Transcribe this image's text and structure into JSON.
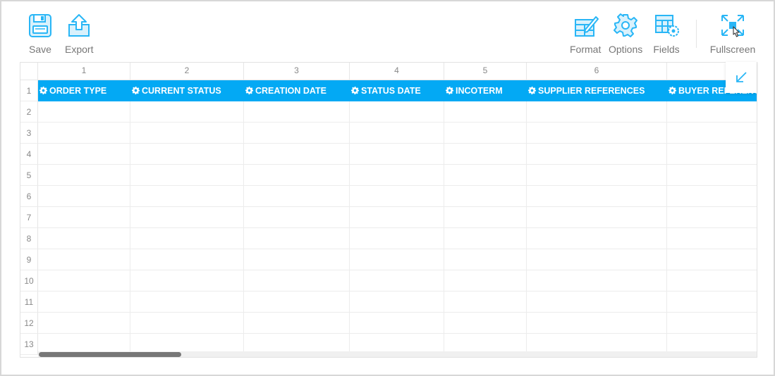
{
  "toolbar": {
    "left": [
      {
        "label": "Save",
        "icon": "save-icon"
      },
      {
        "label": "Export",
        "icon": "export-icon"
      }
    ],
    "right": [
      {
        "label": "Format",
        "icon": "format-icon"
      },
      {
        "label": "Options",
        "icon": "options-icon"
      },
      {
        "label": "Fields",
        "icon": "fields-icon"
      },
      {
        "label": "Fullscreen",
        "icon": "fullscreen-icon"
      }
    ]
  },
  "grid": {
    "columns": [
      "1",
      "2",
      "3",
      "4",
      "5",
      "6",
      ""
    ],
    "rows": [
      "1",
      "2",
      "3",
      "4",
      "5",
      "6",
      "7",
      "8",
      "9",
      "10",
      "11",
      "12",
      "13"
    ],
    "fields": [
      "ORDER TYPE",
      "CURRENT STATUS",
      "CREATION DATE",
      "STATUS DATE",
      "INCOTERM",
      "SUPPLIER REFERENCES",
      "BUYER REFERENCES"
    ]
  },
  "colors": {
    "accent": "#03a9f4",
    "icon": "#29b6f6",
    "label": "#777777"
  },
  "mini_button": {
    "icon": "collapse-arrow-icon"
  }
}
